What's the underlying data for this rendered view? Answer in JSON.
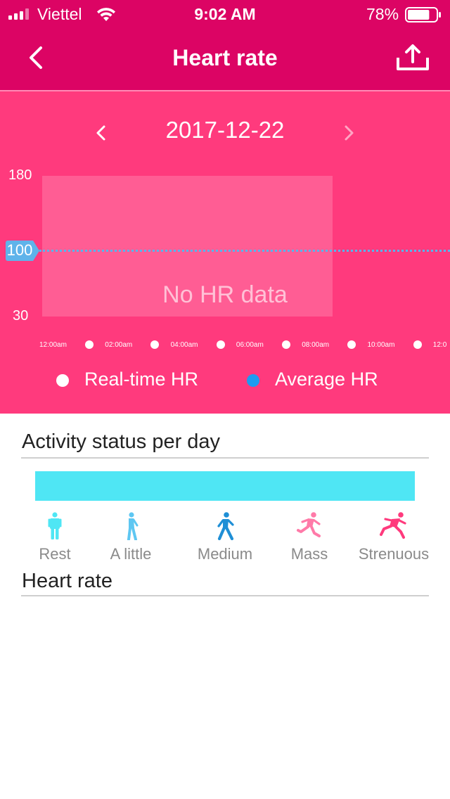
{
  "status_bar": {
    "carrier": "Viettel",
    "time": "9:02 AM",
    "battery_percent": "78%",
    "battery_level": 0.78
  },
  "nav": {
    "title": "Heart rate",
    "back_icon": "chevron-left-icon",
    "share_icon": "upload-icon"
  },
  "chart": {
    "date": "2017-12-22",
    "y_max_label": "180",
    "y_min_label": "30",
    "empty_message": "No HR data",
    "x_ticks": [
      "12:00am",
      "02:00am",
      "04:00am",
      "06:00am",
      "08:00am",
      "10:00am",
      "12:0"
    ],
    "legend": [
      {
        "label": "Real-time HR",
        "color": "#ffffff"
      },
      {
        "label": "Average HR",
        "color": "#1e9bf0"
      }
    ]
  },
  "chart_data": {
    "type": "line",
    "title": "",
    "xlabel": "",
    "ylabel": "",
    "ylim": [
      30,
      180
    ],
    "x_ticks": [
      "12:00am",
      "02:00am",
      "04:00am",
      "06:00am",
      "08:00am",
      "10:00am",
      "12:0"
    ],
    "series": [
      {
        "name": "Real-time HR",
        "values": []
      },
      {
        "name": "Average HR",
        "values": [
          100
        ]
      }
    ],
    "reference_line": {
      "value": 100,
      "label": "100"
    },
    "empty_message": "No HR data",
    "grid": false,
    "legend_position": "bottom"
  },
  "activity": {
    "title": "Activity status per day",
    "bar_color": "#4fe6f4",
    "levels": [
      {
        "label": "Rest",
        "icon": "standing-person-icon",
        "color": "#4fe6f4"
      },
      {
        "label": "A little",
        "icon": "slow-walk-icon",
        "color": "#5ec7f2"
      },
      {
        "label": "Medium",
        "icon": "walking-person-icon",
        "color": "#1f8fd6"
      },
      {
        "label": "Mass",
        "icon": "running-person-icon",
        "color": "#ff7aa8"
      },
      {
        "label": "Strenuous",
        "icon": "sprinting-person-icon",
        "color": "#ff3a7d"
      }
    ]
  },
  "heart_rate_section": {
    "title": "Heart rate"
  }
}
